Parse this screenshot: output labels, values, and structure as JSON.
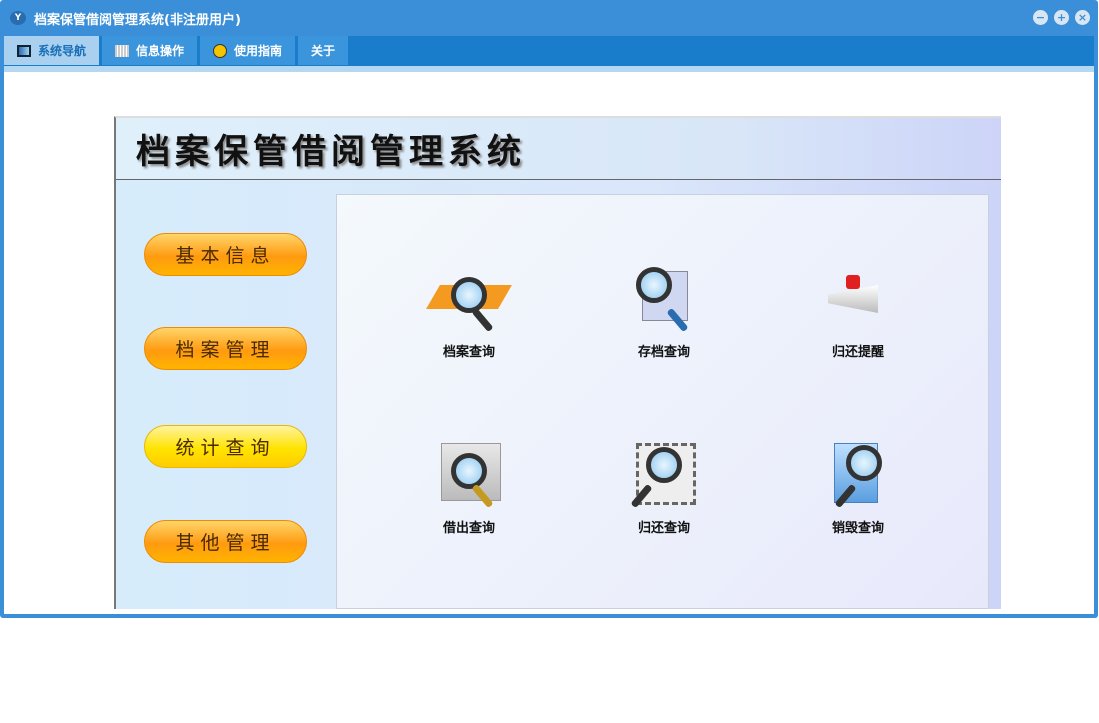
{
  "window": {
    "title": "档案保管借阅管理系统(非注册用户)",
    "logo_text": "Y"
  },
  "tabs": [
    {
      "label": "系统导航",
      "active": true
    },
    {
      "label": "信息操作"
    },
    {
      "label": "使用指南"
    },
    {
      "label": "关于"
    }
  ],
  "banner": {
    "title": "档案保管借阅管理系统"
  },
  "nav": [
    "基本信息",
    "档案管理",
    "统计查询",
    "其他管理"
  ],
  "items": [
    {
      "label": "档案查询",
      "icon": "book-search-icon"
    },
    {
      "label": "存档查询",
      "icon": "archive-search-icon"
    },
    {
      "label": "归还提醒",
      "icon": "megaphone-icon"
    },
    {
      "label": "借出查询",
      "icon": "picture-search-icon"
    },
    {
      "label": "归还查询",
      "icon": "film-search-icon"
    },
    {
      "label": "销毁查询",
      "icon": "files-search-icon"
    }
  ]
}
